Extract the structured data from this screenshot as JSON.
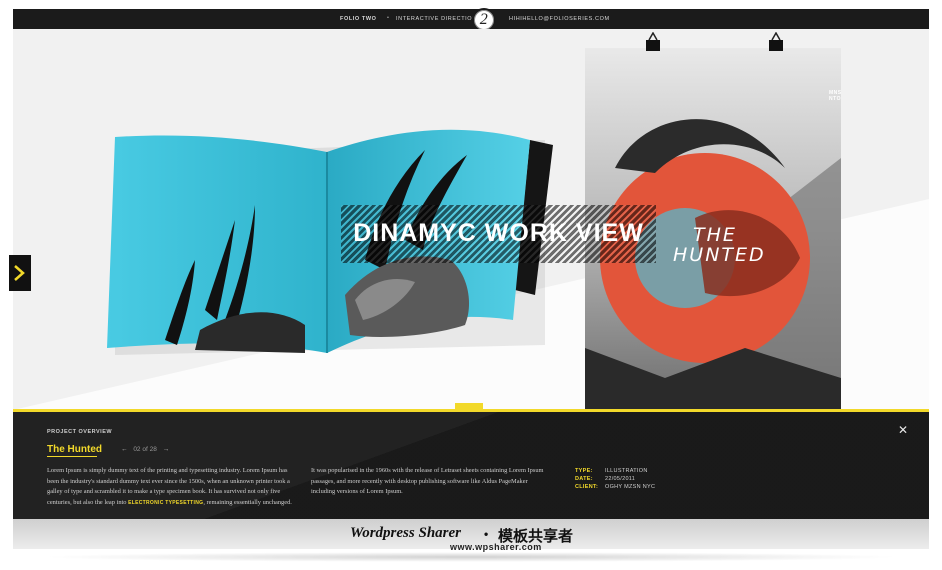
{
  "header": {
    "left": "FOLIO TWO",
    "separator": "•",
    "middle": "INTERACTIVE DIRECTION",
    "logo": "2",
    "right": "HIHIHELLO@FOLIOSERIES.COM"
  },
  "hero": {
    "banner": "DINAMYC WORK VIEW",
    "poster_title_line1": "THE",
    "poster_title_line2": "HUNTED",
    "poster_tag": "MNSN NTON"
  },
  "panel": {
    "section": "PROJECT OVERVIEW",
    "title": "The Hunted",
    "pager": {
      "prev": "←",
      "label": "02 of 28",
      "next": "→"
    },
    "text1_a": "Lorem Ipsum is simply dummy text of the printing and typesetting industry. Lorem Ipsum has been the industry's standard dummy text ever since the 1500s, when an unknown printer took a galley of type and scrambled it to make a type specimen book. It has survived not only five centuries, but also the leap into ",
    "text1_hl": "ELECTRONIC TYPESETTING",
    "text1_b": ", remaining essentially unchanged.",
    "text2": "It was popularised in the 1960s with the release of Letraset sheets containing Lorem Ipsum passages, and more recently with desktop publishing software like Aldus PageMaker including versions of Lorem Ipsum.",
    "meta": [
      {
        "key": "TYPE:",
        "value": "ILLUSTRATION"
      },
      {
        "key": "DATE:",
        "value": "22/05/2011"
      },
      {
        "key": "CLIENT:",
        "value": "OGHY MZSN NYC"
      }
    ],
    "close": "✕"
  },
  "watermark": {
    "brand_en": "Wordpress Sharer",
    "dot": "•",
    "brand_cn": "模板共享者",
    "url": "www.wpsharer.com"
  },
  "colors": {
    "accent": "#f2d92a",
    "cyan": "#3cc3dc",
    "poster_red": "#e2553a",
    "dark": "#222222"
  },
  "icons": {
    "side_arrow": "chevron-right-icon",
    "close": "close-icon",
    "clip": "binder-clip-icon"
  }
}
